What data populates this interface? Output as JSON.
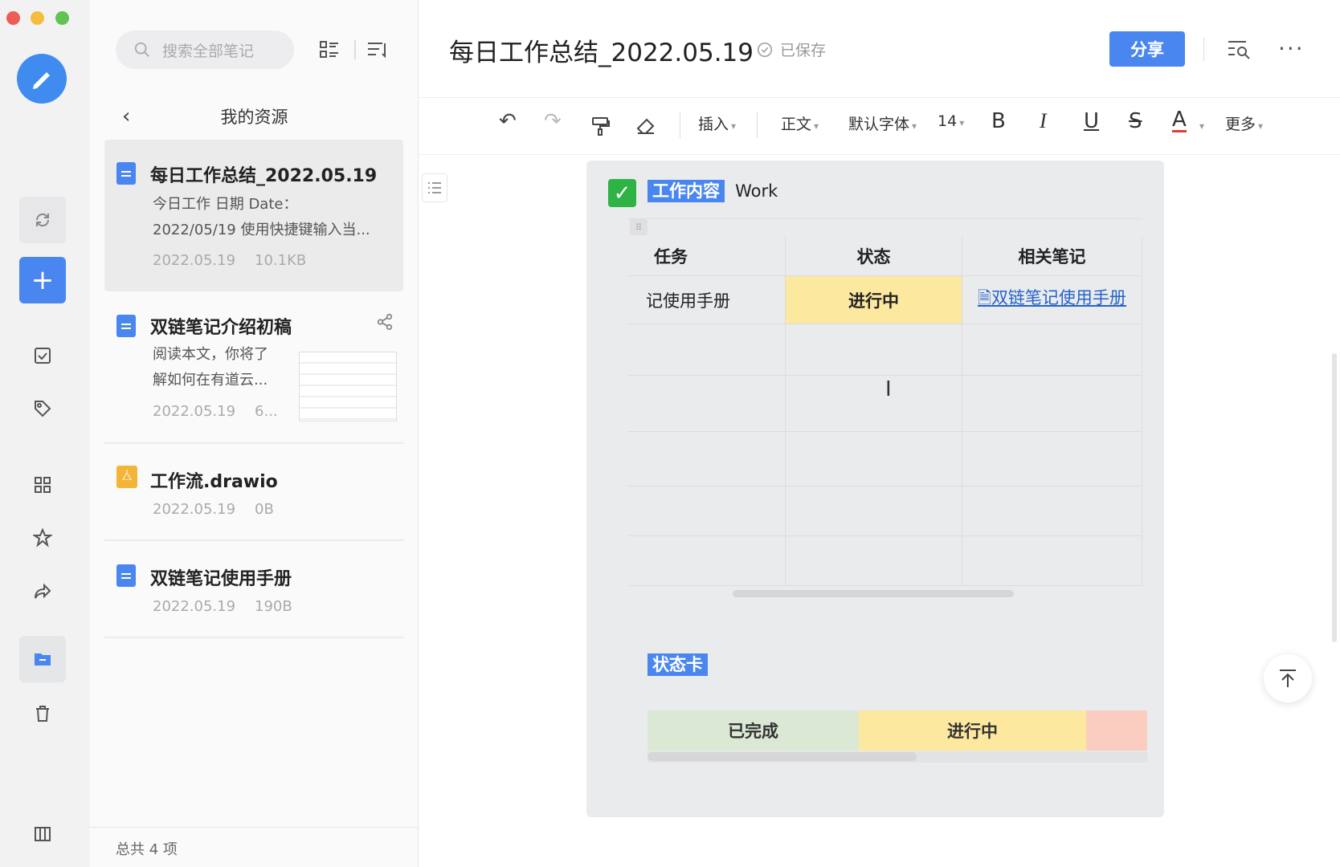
{
  "rail": {
    "items": [
      "refresh",
      "new",
      "todo",
      "tags",
      "apps",
      "favorites",
      "shared",
      "my-files",
      "trash",
      "layout"
    ]
  },
  "list": {
    "search_placeholder": "搜索全部笔记",
    "back_title": "我的资源",
    "notes": [
      {
        "title": "每日工作总结_2022.05.19",
        "desc1": "今日工作  日期 Date：",
        "desc2": "2022/05/19 使用快捷键输入当...",
        "date": "2022.05.19",
        "size": "10.1KB"
      },
      {
        "title": "双链笔记介绍初稿",
        "desc1": "阅读本文，你将了",
        "desc2": "解如何在有道云...",
        "date": "2022.05.19",
        "size": "6..."
      },
      {
        "title": "工作流.drawio",
        "date": "2022.05.19",
        "size": "0B"
      },
      {
        "title": "双链笔记使用手册",
        "date": "2022.05.19",
        "size": "190B"
      }
    ],
    "footer": "总共 4 项"
  },
  "editor": {
    "title": "每日工作总结_2022.05.19",
    "saved": "已保存",
    "share": "分享",
    "toolbar": {
      "insert": "插入",
      "style": "正文",
      "font": "默认字体",
      "size": "14",
      "bold": "B",
      "italic": "I",
      "underline": "U",
      "strike": "S",
      "color": "A",
      "more": "更多"
    },
    "work_label": "工作内容",
    "work_en": "Work",
    "table": {
      "headers": [
        "任务",
        "状态",
        "相关笔记"
      ],
      "row": [
        "记使用手册",
        "进行中",
        "双链笔记使用手册"
      ]
    },
    "status_label": "状态卡",
    "status": [
      "已完成",
      "进行中"
    ]
  },
  "colors": {
    "accent": "#4a86f0",
    "in_progress": "#fde8a0",
    "done": "#dbe8d4",
    "todo": "#fbcdc0"
  }
}
